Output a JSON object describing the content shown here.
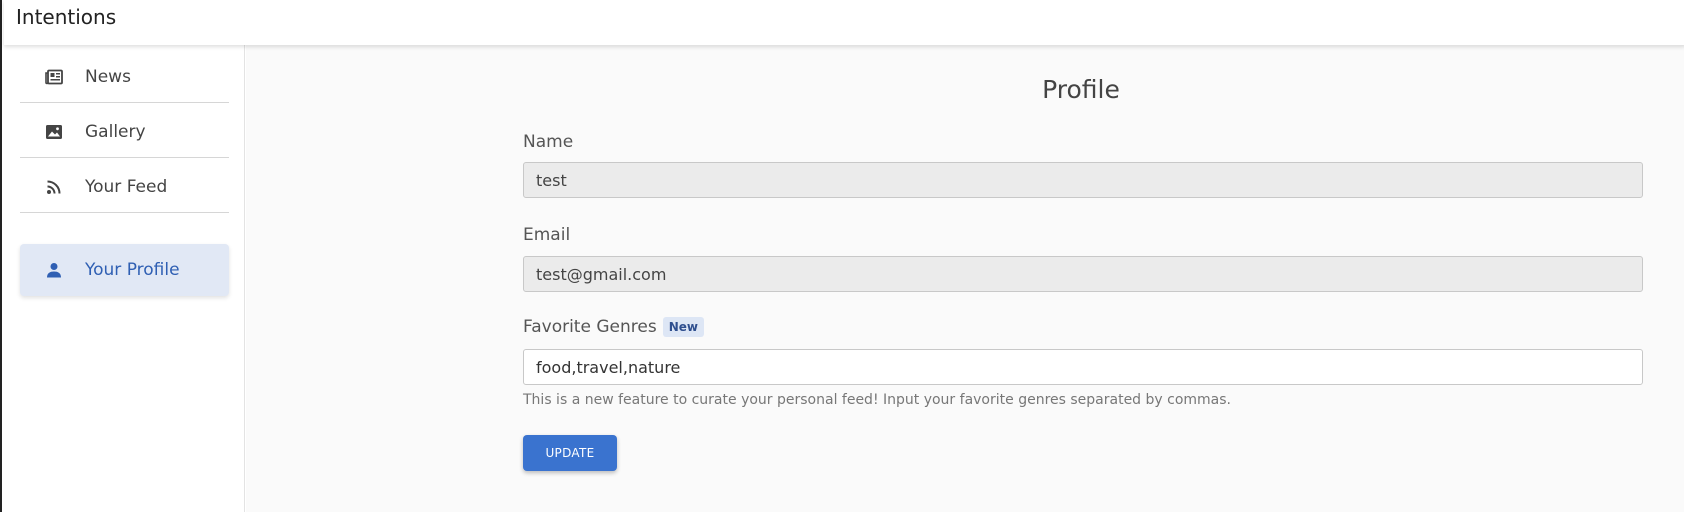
{
  "app": {
    "title": "Intentions"
  },
  "sidebar": {
    "items": [
      {
        "label": "News",
        "icon": "newspaper-icon",
        "active": false
      },
      {
        "label": "Gallery",
        "icon": "image-icon",
        "active": false
      },
      {
        "label": "Your Feed",
        "icon": "rss-icon",
        "active": false
      },
      {
        "label": "Your Profile",
        "icon": "person-icon",
        "active": true
      }
    ]
  },
  "profile": {
    "title": "Profile",
    "name": {
      "label": "Name",
      "value": "test"
    },
    "email": {
      "label": "Email",
      "value": "test@gmail.com"
    },
    "genres": {
      "label": "Favorite Genres",
      "badge": "New",
      "value": "food,travel,nature",
      "helper": "This is a new feature to curate your personal feed! Input your favorite genres separated by commas."
    },
    "update_label": "UPDATE"
  },
  "colors": {
    "accent": "#3a73cf",
    "active_nav_bg": "#e1e8f5",
    "active_nav_text": "#2f5fb3",
    "badge_bg": "#dde6f5"
  }
}
